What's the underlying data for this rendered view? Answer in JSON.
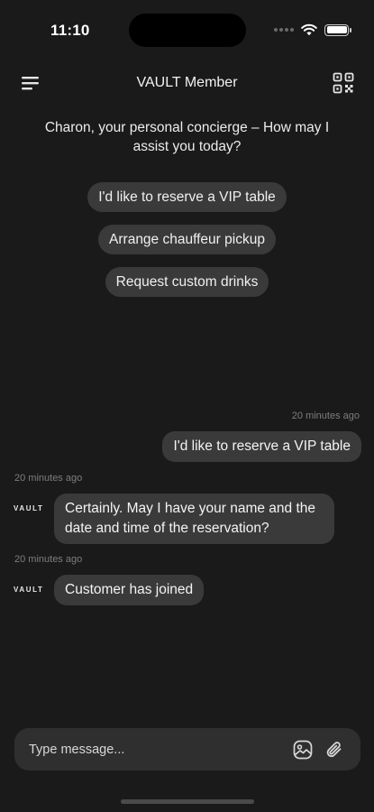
{
  "status_bar": {
    "time": "11:10",
    "battery_level": 1.0
  },
  "header": {
    "title": "VAULT Member"
  },
  "greeting": "Charon, your personal concierge – How may I assist you today?",
  "suggestions": [
    "I'd like to reserve a VIP table",
    "Arrange chauffeur pickup",
    "Request custom drinks"
  ],
  "messages": {
    "outgoing_timestamp": "20 minutes ago",
    "outgoing_text": "I'd like to reserve a VIP table",
    "agent_timestamp_1": "20 minutes ago",
    "agent_logo": "VAULT",
    "agent_text_1": "Certainly. May I have your name and the date and time of the reservation?",
    "agent_timestamp_2": "20 minutes ago",
    "agent_text_2": "Customer has joined"
  },
  "composer": {
    "placeholder": "Type message..."
  },
  "icons": {
    "menu": "menu-icon",
    "qr": "qr-code-icon",
    "image": "image-icon",
    "attach": "paperclip-icon"
  },
  "colors": {
    "background": "#1a1a1a",
    "bubble": "#3a3a3a",
    "composer": "#2f2f2f",
    "muted_text": "#7d7d7d"
  }
}
